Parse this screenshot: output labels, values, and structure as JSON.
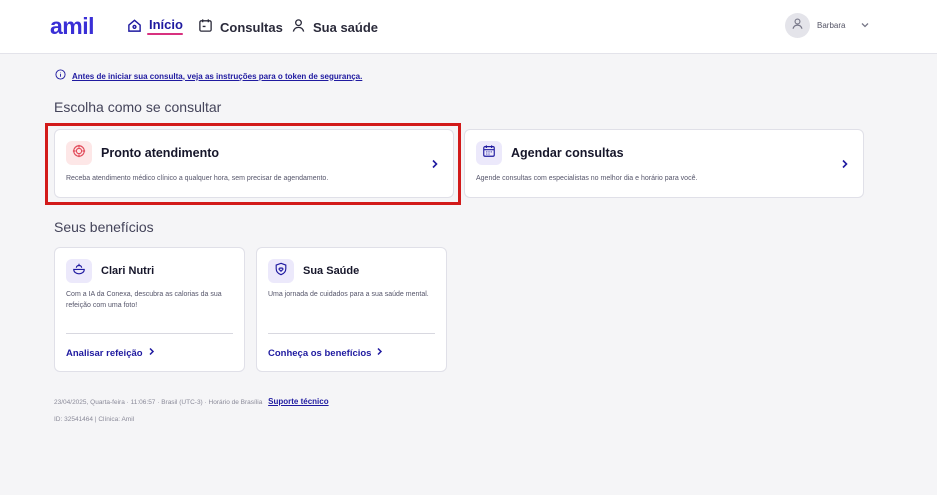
{
  "header": {
    "logo": "amil",
    "nav": [
      {
        "label": "Início",
        "icon": "home-icon",
        "active": true
      },
      {
        "label": "Consultas",
        "icon": "calendar-doc-icon"
      },
      {
        "label": "Sua saúde",
        "icon": "person-icon"
      }
    ],
    "user": {
      "name": "Barbara"
    }
  },
  "info_banner": {
    "text": "Antes de iniciar sua consulta, veja as instruções para o token de segurança."
  },
  "consult_section": {
    "title": "Escolha como se consultar",
    "cards": [
      {
        "title": "Pronto atendimento",
        "desc": "Receba atendimento médico clínico a qualquer hora, sem precisar de agendamento.",
        "icon": "target-icon",
        "highlighted": true
      },
      {
        "title": "Agendar consultas",
        "desc": "Agende consultas com especialistas no melhor dia e horário para você.",
        "icon": "calendar-icon"
      }
    ]
  },
  "benefits_section": {
    "title": "Seus benefícios",
    "cards": [
      {
        "title": "Clari Nutri",
        "desc": "Com a IA da Conexa, descubra as calorias da sua refeição com uma foto!",
        "link": "Analisar refeição",
        "icon": "food-bowl-icon"
      },
      {
        "title": "Sua Saúde",
        "desc": "Uma jornada de cuidados para a sua saúde mental.",
        "link": "Conheça os benefícios",
        "icon": "shield-heart-icon"
      }
    ]
  },
  "footer": {
    "datetime": "23/04/2025, Quarta-feira · 11:06:57 · Brasil (UTC-3) · Horário de Brasília",
    "support_link": "Suporte técnico",
    "ids": "ID: 32541464 | Clínica: Amil"
  },
  "colors": {
    "brand": "#3a2fd6",
    "link": "#1f1aa0",
    "active_underline": "#d8317f",
    "highlight_border": "#d21a1a"
  }
}
